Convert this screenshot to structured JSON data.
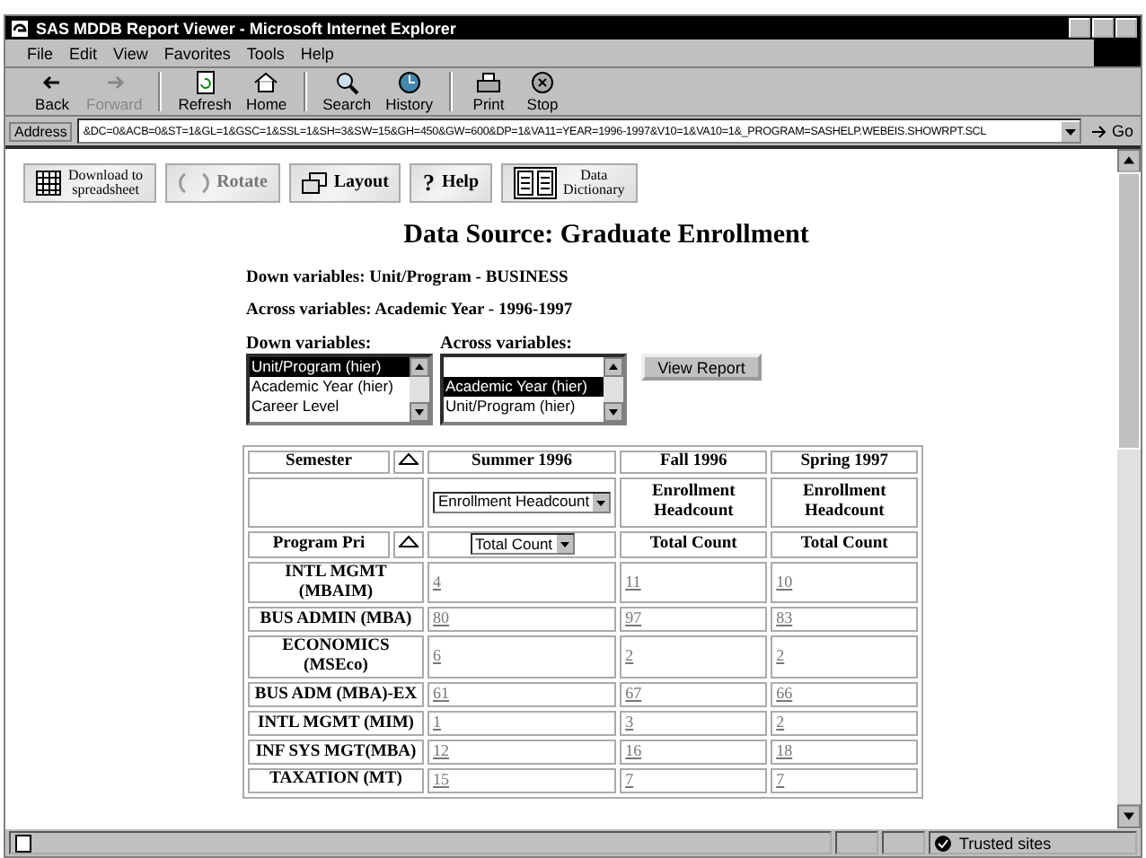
{
  "window": {
    "title": "SAS MDDB Report Viewer - Microsoft Internet Explorer"
  },
  "menu": [
    "File",
    "Edit",
    "View",
    "Favorites",
    "Tools",
    "Help"
  ],
  "toolbar": [
    {
      "label": "Back",
      "disabled": false
    },
    {
      "label": "Forward",
      "disabled": true
    },
    {
      "label": "Refresh",
      "disabled": false
    },
    {
      "label": "Home",
      "disabled": false
    },
    {
      "label": "Search",
      "disabled": false
    },
    {
      "label": "History",
      "disabled": false
    },
    {
      "label": "Print",
      "disabled": false
    },
    {
      "label": "Stop",
      "disabled": false
    }
  ],
  "address": {
    "label": "Address",
    "value": "&DC=0&ACB=0&ST=1&GL=1&GSC=1&SSL=1&SH=3&SW=15&GH=450&GW=600&DP=1&VA11=YEAR=1996-1997&V10=1&VA10=1&_PROGRAM=SASHELP.WEBEIS.SHOWRPT.SCL",
    "go": "Go"
  },
  "page_buttons": [
    {
      "lines": [
        "Download to",
        "spreadsheet"
      ],
      "disabled": false
    },
    {
      "lines": [
        "Rotate"
      ],
      "disabled": true
    },
    {
      "lines": [
        "Layout"
      ],
      "disabled": false
    },
    {
      "lines": [
        "Help"
      ],
      "symbol": "?",
      "disabled": false
    },
    {
      "lines": [
        "Data",
        "Dictionary"
      ],
      "disabled": false
    }
  ],
  "heading": "Data Source: Graduate Enrollment",
  "summary": [
    "Down variables: Unit/Program - BUSINESS",
    "Across variables: Academic Year - 1996-1997"
  ],
  "down_variables": {
    "label": "Down variables:",
    "options": [
      {
        "label": "Unit/Program (hier)",
        "selected": true
      },
      {
        "label": "Academic Year (hier)",
        "selected": false
      },
      {
        "label": "Career Level",
        "selected": false
      }
    ]
  },
  "across_variables": {
    "label": "Across variables:",
    "options": [
      {
        "label": "Academic Year (hier)",
        "selected": true
      },
      {
        "label": "Unit/Program (hier)",
        "selected": false
      }
    ]
  },
  "view_report_button": "View Report",
  "table": {
    "column_header_label": "Semester",
    "row_header_label": "Program Pri",
    "columns": [
      {
        "label": "Summer 1996",
        "measure": {
          "kind": "dropdown",
          "text": "Enrollment Headcount"
        },
        "statistic": {
          "kind": "dropdown",
          "text": "Total Count"
        }
      },
      {
        "label": "Fall 1996",
        "measure": {
          "kind": "text",
          "text": "Enrollment Headcount"
        },
        "statistic": {
          "kind": "text",
          "text": "Total Count"
        }
      },
      {
        "label": "Spring 1997",
        "measure": {
          "kind": "text",
          "text": "Enrollment Headcount"
        },
        "statistic": {
          "kind": "text",
          "text": "Total Count"
        }
      }
    ],
    "rows": [
      {
        "label": "INTL MGMT (MBAIM)",
        "values": [
          "4",
          "11",
          "10"
        ]
      },
      {
        "label": "BUS ADMIN (MBA)",
        "values": [
          "80",
          "97",
          "83"
        ]
      },
      {
        "label": "ECONOMICS (MSEco)",
        "values": [
          "6",
          "2",
          "2"
        ]
      },
      {
        "label": "BUS ADM (MBA)-EX",
        "values": [
          "61",
          "67",
          "66"
        ]
      },
      {
        "label": "INTL MGMT (MIM)",
        "values": [
          "1",
          "3",
          "2"
        ]
      },
      {
        "label": "INF SYS MGT(MBA)",
        "values": [
          "12",
          "16",
          "18"
        ]
      },
      {
        "label": "TAXATION (MT)",
        "values": [
          "15",
          "7",
          "7"
        ]
      }
    ]
  },
  "status_bar": {
    "zone": "Trusted sites"
  }
}
